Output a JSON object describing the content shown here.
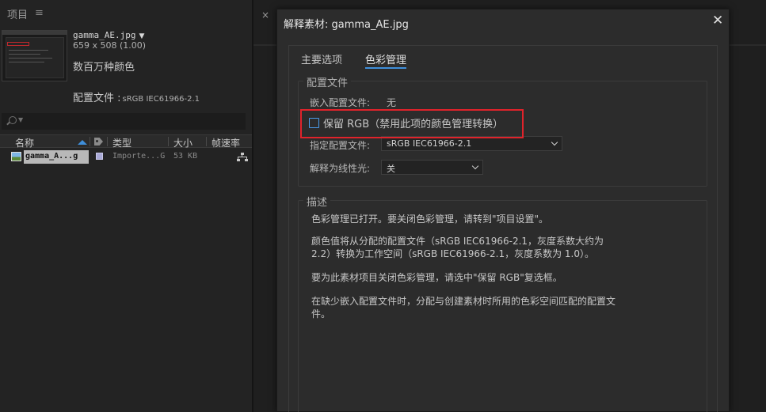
{
  "project_panel": {
    "tab_label": "项目",
    "menu_icon": "hamburger-menu-icon",
    "footage": {
      "name": "gamma_AE.jpg",
      "dimensions": "659 x 508 (1.00)",
      "colors": "数百万种颜色",
      "profile_label": "配置文件 :",
      "profile_value": "sRGB IEC61966-2.1"
    },
    "search": {
      "icon": "search-icon"
    },
    "columns": {
      "name": "名称",
      "type": "类型",
      "size": "大小",
      "framerate": "帧速率"
    },
    "rows": [
      {
        "name": "gamma_A...g",
        "type": "Importe...G",
        "size": "53 KB",
        "label_color": "#a9a9d6"
      }
    ]
  },
  "dialog": {
    "title": "解释素材: gamma_AE.jpg",
    "close_icon": "close-icon",
    "tabs": [
      {
        "label": "主要选项",
        "active": false
      },
      {
        "label": "色彩管理",
        "active": true
      }
    ],
    "profile_group": {
      "legend": "配置文件",
      "embedded_label": "嵌入配置文件:",
      "embedded_value": "无",
      "preserve_rgb_label": "保留 RGB（禁用此项的颜色管理转换）",
      "preserve_rgb_checked": false,
      "assign_profile_label": "指定配置文件:",
      "assign_profile_value": "sRGB IEC61966-2.1",
      "linear_label": "解释为线性光:",
      "linear_value": "关"
    },
    "description": {
      "legend": "描述",
      "paragraphs": [
        "色彩管理已打开。要关闭色彩管理，请转到\"项目设置\"。",
        "颜色值将从分配的配置文件（sRGB IEC61966-2.1，灰度系数大约为 2.2）转换为工作空间（sRGB IEC61966-2.1，灰度系数为 1.0）。",
        "要为此素材项目关闭色彩管理，请选中\"保留 RGB\"复选框。",
        "在缺少嵌入配置文件时，分配与创建素材时所用的色彩空间匹配的配置文件。"
      ]
    }
  },
  "colors": {
    "accent": "#3f8fdb",
    "highlight": "#e0232b",
    "panel_bg": "#232323",
    "dialog_bg": "#2c2c2c"
  }
}
